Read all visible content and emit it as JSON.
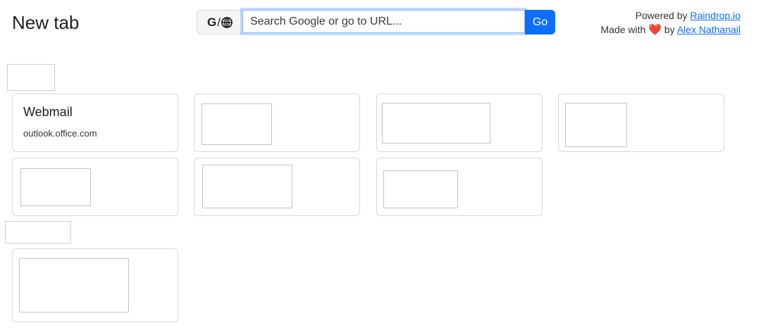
{
  "header": {
    "title": "New tab"
  },
  "search": {
    "engine_toggle_label": "G",
    "engine_toggle_separator": "/",
    "engine_toggle_icon": "globe-icon",
    "placeholder": "Search Google or go to URL...",
    "value": "",
    "go_label": "Go"
  },
  "credits": {
    "powered_prefix": "Powered by",
    "powered_link": "Raindrop.io",
    "made_prefix": "Made with",
    "heart_icon": "heart-icon",
    "made_by": "by",
    "author_link": "Alex Nathanail"
  },
  "colors": {
    "accent": "#0d6efd",
    "heart": "#e25555",
    "card_border": "#d7d7d7"
  },
  "bookmarks": [
    {
      "title": "Webmail",
      "domain": "outlook.office.com"
    }
  ]
}
